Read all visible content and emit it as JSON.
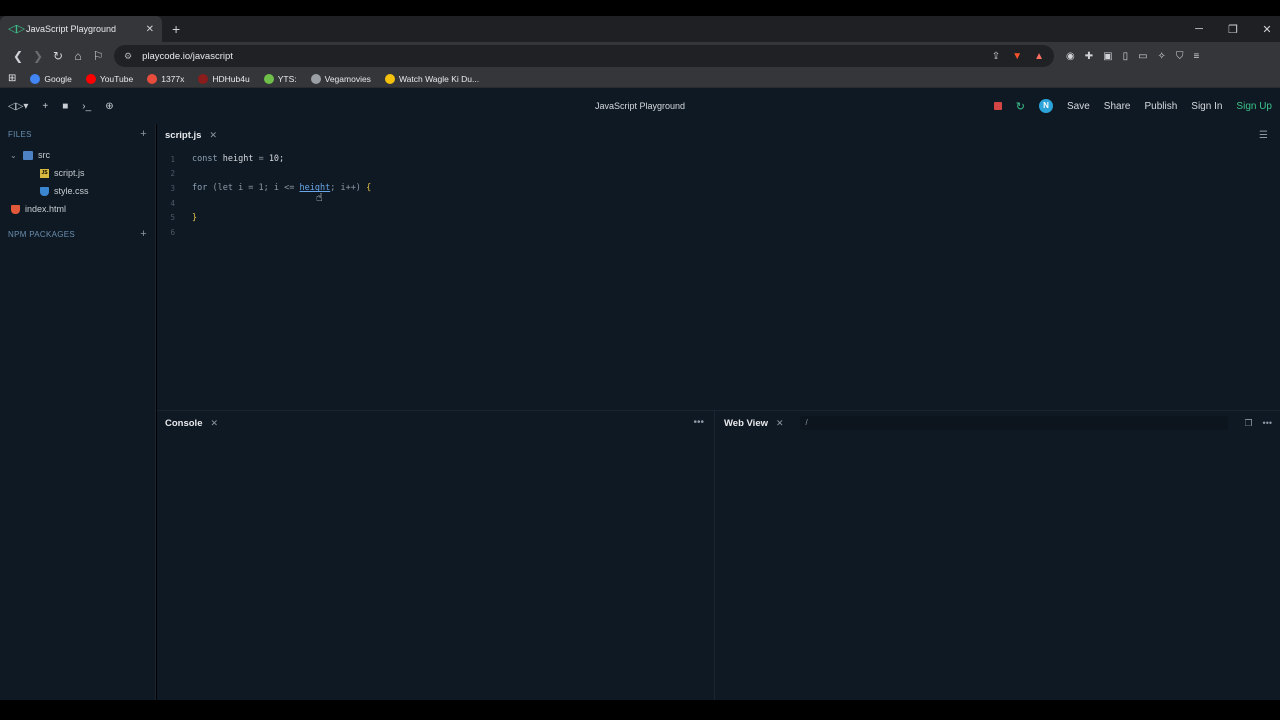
{
  "browser": {
    "tab_title": "JavaScript Playground",
    "url": "playcode.io/javascript",
    "bookmarks": [
      {
        "label": "Google",
        "icon": "google-icon",
        "color": "#4285f4"
      },
      {
        "label": "YouTube",
        "icon": "youtube-icon",
        "color": "#ff0000"
      },
      {
        "label": "1377x",
        "icon": "x-icon",
        "color": "#e84c3d"
      },
      {
        "label": "HDHub4u",
        "icon": "hdhub-icon",
        "color": "#8b1c1c"
      },
      {
        "label": "YTS:",
        "icon": "yts-icon",
        "color": "#6fbf4b"
      },
      {
        "label": "Vegamovies",
        "icon": "v-icon",
        "color": "#9aa0a6"
      },
      {
        "label": "Watch Wagle Ki Du...",
        "icon": "check-icon",
        "color": "#f4c20d"
      }
    ]
  },
  "app": {
    "title": "JavaScript Playground",
    "avatar_letter": "N",
    "save": "Save",
    "share": "Share",
    "publish": "Publish",
    "sign_in": "Sign In",
    "sign_up": "Sign Up"
  },
  "sidebar": {
    "files_label": "FILES",
    "src_folder": "src",
    "script_file": "script.js",
    "style_file": "style.css",
    "index_file": "index.html",
    "npm_label": "NPM PACKAGES"
  },
  "editor": {
    "tab": "script.js",
    "lines": [
      "1",
      "2",
      "3",
      "4",
      "5",
      "6"
    ],
    "code": {
      "l1_kw": "const",
      "l1_id": "height",
      "l1_op": "=",
      "l1_num": "10;",
      "l3_kw": "for",
      "l3_a": "(let i = 1; i <=",
      "l3_link": "height",
      "l3_b": "; i++)",
      "l3_brace": "{",
      "l5_brace": "}"
    }
  },
  "console": {
    "title": "Console"
  },
  "webview": {
    "title": "Web View",
    "path": "/"
  }
}
